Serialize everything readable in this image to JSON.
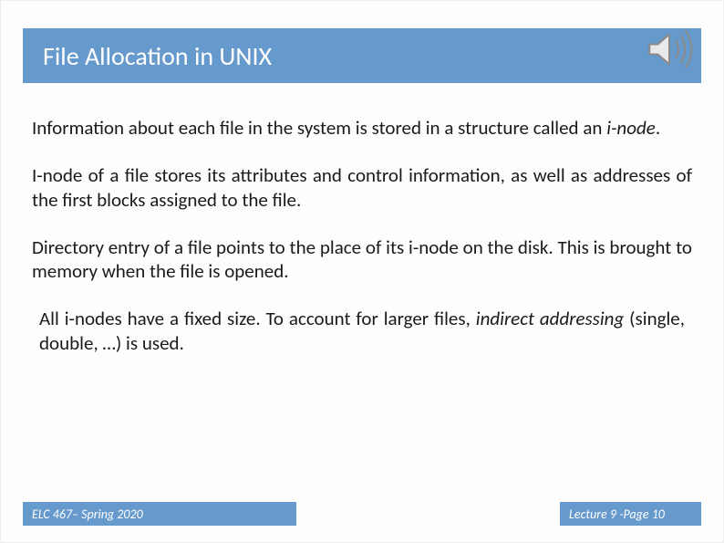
{
  "header": {
    "title": "File Allocation in UNIX"
  },
  "body": {
    "p1_a": "Information about each file in the system is stored in a structure called an ",
    "p1_b": "i-node",
    "p1_c": ".",
    "p2": "I-node of a file stores its attributes and control information, as well as addresses of the first blocks assigned to the file.",
    "p3": "Directory entry of a file points to the place of its i-node on the disk. This is brought to memory when the file is opened.",
    "p4_a": "All i-nodes have a fixed size. To account for larger files, ",
    "p4_b": "indirect addressing",
    "p4_c": " (single, double, …)  is used."
  },
  "footer": {
    "left": "ELC 467– Spring 2020",
    "right": "Lecture 9 -Page 10"
  },
  "icons": {
    "speaker": "speaker-icon"
  }
}
